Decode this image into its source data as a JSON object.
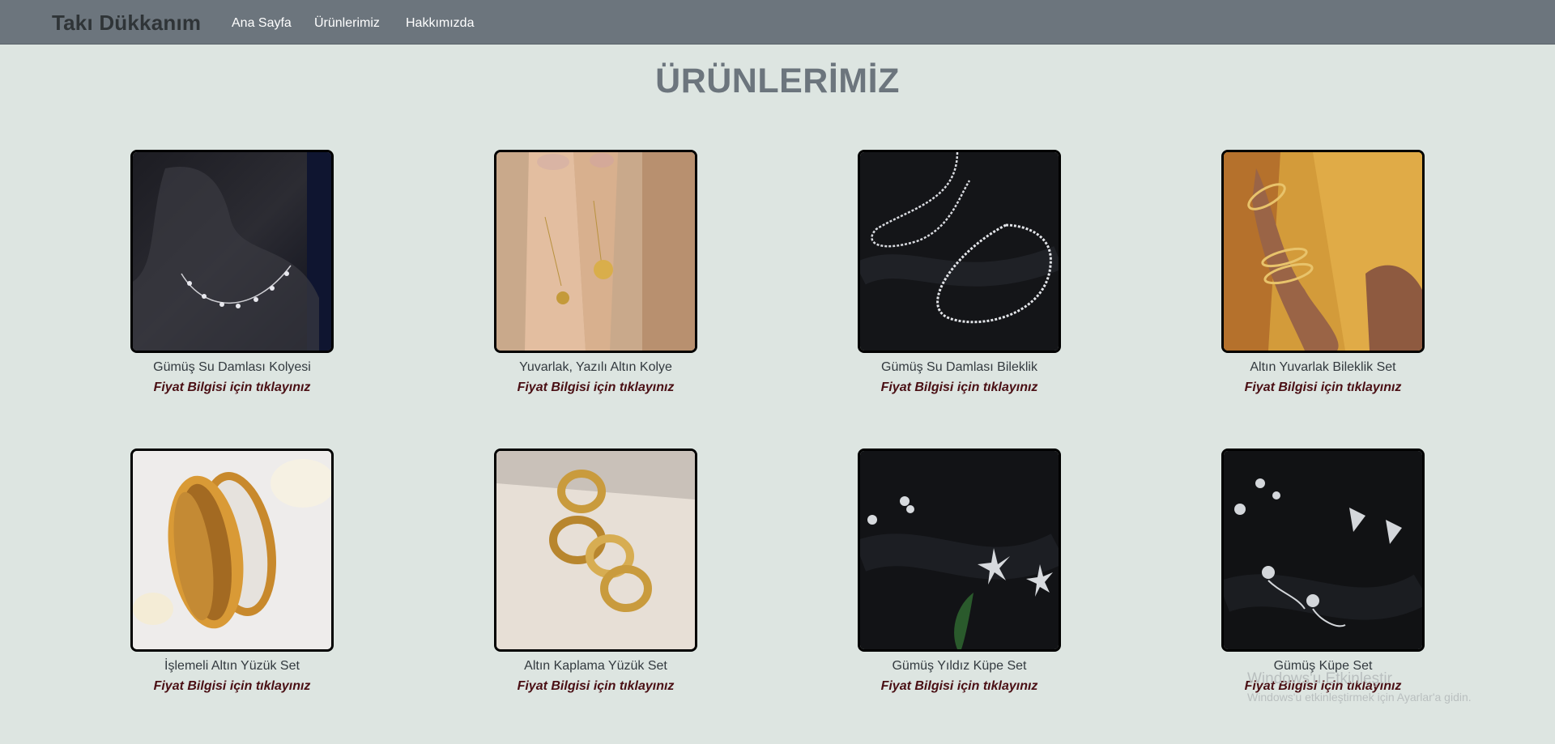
{
  "navbar": {
    "brand": "Takı Dükkanım",
    "links": [
      "Ana Sayfa",
      "Ürünlerimiz",
      "Hakkımızda"
    ]
  },
  "page": {
    "title": "ÜRÜNLERİMİZ"
  },
  "products": [
    {
      "name": "Gümüş Su Damlası Kolyesi",
      "price_link": "Fiyat Bilgisi için tıklayınız",
      "image": "silver-teardrop-necklace-on-black-bust"
    },
    {
      "name": "Yuvarlak, Yazılı Altın Kolye",
      "price_link": "Fiyat Bilgisi için tıklayınız",
      "image": "gold-round-engraved-pendants-on-hands"
    },
    {
      "name": "Gümüş Su Damlası Bileklik",
      "price_link": "Fiyat Bilgisi için tıklayınız",
      "image": "silver-tennis-bracelets-on-black-fabric"
    },
    {
      "name": "Altın Yuvarlak Bileklik Set",
      "price_link": "Fiyat Bilgisi için tıklayınız",
      "image": "gold-bangles-on-wrist-with-yellow-fabric"
    },
    {
      "name": "İşlemeli Altın Yüzük Set",
      "price_link": "Fiyat Bilgisi için tıklayınız",
      "image": "engraved-gold-cuffs"
    },
    {
      "name": "Altın Kaplama Yüzük Set",
      "price_link": "Fiyat Bilgisi için tıklayınız",
      "image": "stacked-gold-rings"
    },
    {
      "name": "Gümüş Yıldız Küpe Set",
      "price_link": "Fiyat Bilgisi için tıklayınız",
      "image": "silver-star-earrings-on-black-fabric"
    },
    {
      "name": "Gümüş Küpe Set",
      "price_link": "Fiyat Bilgisi için tıklayınız",
      "image": "silver-earrings-set-on-black-fabric"
    }
  ],
  "watermark": {
    "line1": "Windows'u Etkinleştir",
    "line2": "Windows'u etkinleştirmek için Ayarlar'a gidin."
  },
  "colors": {
    "navbar_bg": "#6c757d",
    "page_bg": "#dde5e1",
    "title": "#6c757d",
    "price_link": "#4a0f14"
  }
}
